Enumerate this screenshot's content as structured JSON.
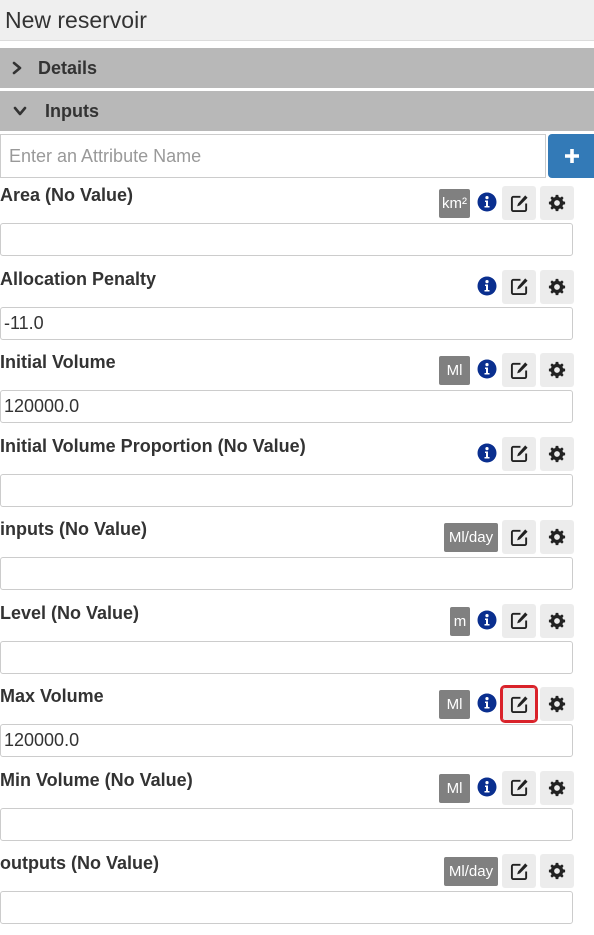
{
  "window": {
    "title": "New reservoir"
  },
  "sections": {
    "details": {
      "label": "Details",
      "icon": "chevron-right-icon"
    },
    "inputs": {
      "label": "Inputs",
      "icon": "chevron-down-icon"
    }
  },
  "search": {
    "placeholder": "Enter an Attribute Name",
    "value": "",
    "add_icon": "plus-icon"
  },
  "colors": {
    "section_bg": "#b8b8b8",
    "primary": "#337ab7",
    "unit_badge": "#808080",
    "info": "#0a2f8f",
    "highlight": "#d9222a"
  },
  "attributes": [
    {
      "label": "Area (No Value)",
      "value": "",
      "unit": "km²",
      "info": true
    },
    {
      "label": "Allocation Penalty",
      "value": "-11.0",
      "unit": "",
      "info": true
    },
    {
      "label": "Initial Volume",
      "value": "120000.0",
      "unit": "Ml",
      "info": true
    },
    {
      "label": "Initial Volume Proportion (No Value)",
      "value": "",
      "unit": "",
      "info": true
    },
    {
      "label": "inputs (No Value)",
      "value": "",
      "unit": "Ml/day",
      "info": false
    },
    {
      "label": "Level (No Value)",
      "value": "",
      "unit": "m",
      "info": true
    },
    {
      "label": "Max Volume",
      "value": "120000.0",
      "unit": "Ml",
      "info": true,
      "edit_highlighted": true
    },
    {
      "label": "Min Volume (No Value)",
      "value": "",
      "unit": "Ml",
      "info": true
    },
    {
      "label": "outputs (No Value)",
      "value": "",
      "unit": "Ml/day",
      "info": false
    }
  ]
}
